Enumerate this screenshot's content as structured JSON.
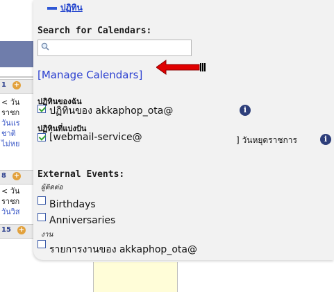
{
  "popup": {
    "title": "ปฏิทิน",
    "search_label": "Search for Calendars:",
    "search_value": "",
    "manage_link": "[Manage Calendars]",
    "my_calendars": {
      "heading": "ปฏิทินของฉัน",
      "items": [
        {
          "label": "ปฏิทินของ akkaphop_ota@",
          "checked": true
        }
      ]
    },
    "shared_calendars": {
      "heading": "ปฏิทินที่แบ่งปัน",
      "items": [
        {
          "label": "[webmail-service@",
          "suffix": "] วันหยุดราชการ",
          "checked": true
        }
      ]
    },
    "external_events": {
      "heading": "External Events:",
      "groups": [
        {
          "label": "ผู้ติดต่อ",
          "items": [
            {
              "label": "Birthdays",
              "checked": false
            },
            {
              "label": "Anniversaries",
              "checked": false
            }
          ]
        },
        {
          "label": "งาน",
          "items": [
            {
              "label": "รายการงานของ akkaphop_ota@",
              "checked": false
            }
          ]
        }
      ]
    }
  },
  "background": {
    "days": [
      "1",
      "8",
      "15"
    ],
    "snippets": [
      "< วัน",
      "ราชก",
      "วันแร",
      "ชาติ",
      "ไม่หย",
      "< วัน",
      "ราชก",
      "วันวิส"
    ]
  },
  "colors": {
    "link": "#1c3fcc",
    "arrow": "#e00000",
    "panel": "#f2f2f2",
    "header_bar": "#6f7dab"
  }
}
